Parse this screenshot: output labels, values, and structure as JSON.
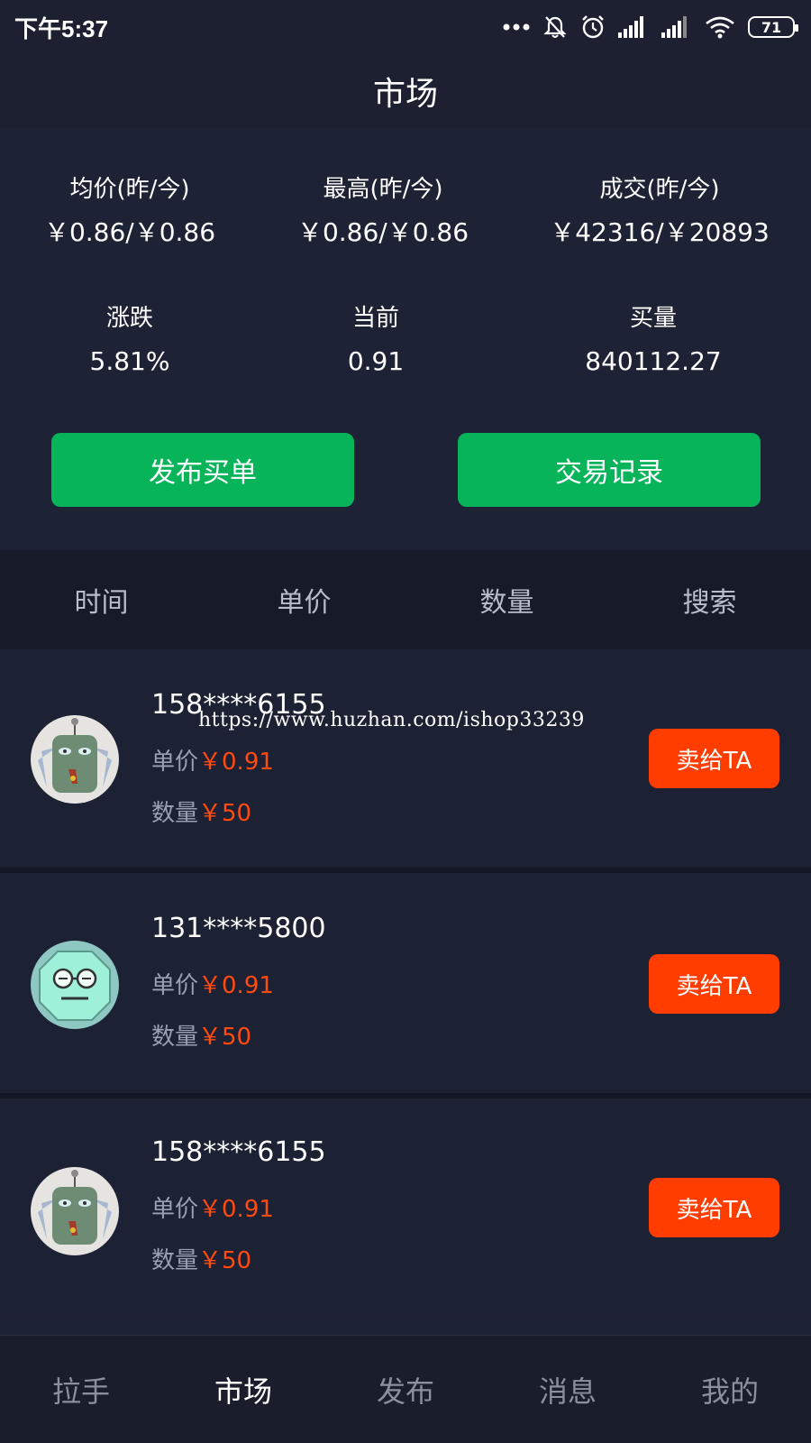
{
  "statusbar": {
    "time": "下午5:37",
    "battery": "71",
    "icons": [
      "more-dots-icon",
      "mute-bell-icon",
      "alarm-icon",
      "signal-icon",
      "signal-icon",
      "wifi-icon",
      "battery-icon"
    ]
  },
  "header": {
    "title": "市场"
  },
  "stats": [
    {
      "label": "均价(昨/今)",
      "value": "￥0.86/￥0.86"
    },
    {
      "label": "最高(昨/今)",
      "value": "￥0.86/￥0.86"
    },
    {
      "label": "成交(昨/今)",
      "value": "￥42316/￥20893"
    },
    {
      "label": "涨跌",
      "value": "5.81%"
    },
    {
      "label": "当前",
      "value": "0.91"
    },
    {
      "label": "买量",
      "value": "840112.27"
    }
  ],
  "actions": {
    "publish_buy": "发布买单",
    "trade_records": "交易记录"
  },
  "filters": [
    "时间",
    "单价",
    "数量",
    "搜索"
  ],
  "orders": [
    {
      "phone": "158****6155",
      "price_label": "单价",
      "price": "￥0.91",
      "qty_label": "数量",
      "qty": "￥50",
      "button": "卖给TA",
      "avatar": "robot-avatar-icon"
    },
    {
      "phone": "131****5800",
      "price_label": "单价",
      "price": "￥0.91",
      "qty_label": "数量",
      "qty": "￥50",
      "button": "卖给TA",
      "avatar": "glasses-face-avatar-icon"
    },
    {
      "phone": "158****6155",
      "price_label": "单价",
      "price": "￥0.91",
      "qty_label": "数量",
      "qty": "￥50",
      "button": "卖给TA",
      "avatar": "robot-avatar-icon"
    }
  ],
  "watermark": "https://www.huzhan.com/ishop33239",
  "tabbar": {
    "items": [
      "拉手",
      "市场",
      "发布",
      "消息",
      "我的"
    ],
    "active": "市场"
  },
  "colors": {
    "background": "#1c2031",
    "green_button": "#08b45a",
    "orange_button": "#ff3d00",
    "price_orange": "#ff4a10"
  }
}
